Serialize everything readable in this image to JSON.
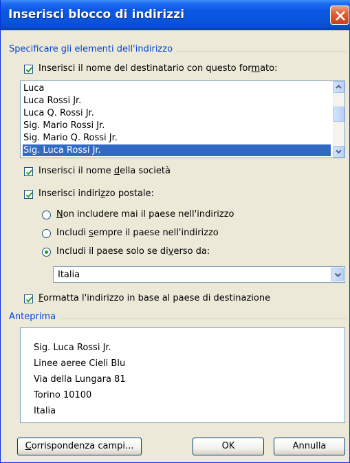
{
  "window": {
    "title": "Inserisci blocco di indirizzi"
  },
  "address_group": {
    "label": "Specificare gli elementi dell'indirizzo",
    "recipient_name": {
      "checked": true,
      "label_pre": "Inserisci il nome del destinatario con questo for",
      "label_accel": "m",
      "label_post": "ato:"
    },
    "name_formats": [
      "Luca",
      "Luca Rossi Jr.",
      "Luca Q. Rossi Jr.",
      "Sig. Mario Rossi Jr.",
      "Sig. Mario Q. Rossi Jr.",
      "Sig. Luca Rossi Jr."
    ],
    "selected_format": "Sig. Luca Rossi Jr.",
    "company_name": {
      "checked": true,
      "label_pre": "Inserisci il nome ",
      "label_accel": "d",
      "label_post": "ella società"
    },
    "postal_address": {
      "checked": true,
      "label_pre": "Inserisci indiri",
      "label_accel": "z",
      "label_post": "zo postale:"
    },
    "country_options": [
      {
        "pre": "",
        "accel": "N",
        "post": "on includere mai il paese nell'indirizzo",
        "selected": false
      },
      {
        "pre": "Includi ",
        "accel": "s",
        "post": "empre il paese nell'indirizzo",
        "selected": false
      },
      {
        "pre": "Includi il paese solo se di",
        "accel": "v",
        "post": "erso da:",
        "selected": true
      }
    ],
    "country_value": "Italia",
    "format_by_country": {
      "checked": true,
      "label_pre": "",
      "label_accel": "F",
      "label_post": "ormatta l'indirizzo in base al paese di destinazione"
    }
  },
  "preview_group": {
    "label": "Anteprima",
    "lines": [
      "Sig. Luca Rossi Jr.",
      "Linee aeree Cieli Blu",
      "Via della Lungara 81",
      "Torino 10100",
      "Italia"
    ]
  },
  "buttons": {
    "match_fields": {
      "pre": "",
      "accel": "C",
      "post": "orrispondenza campi..."
    },
    "ok": "OK",
    "cancel": "Annulla"
  },
  "colors": {
    "titlebar": "#0a55dc",
    "group_label": "#0046d5",
    "selection": "#316ac5",
    "face": "#ece9d8"
  }
}
